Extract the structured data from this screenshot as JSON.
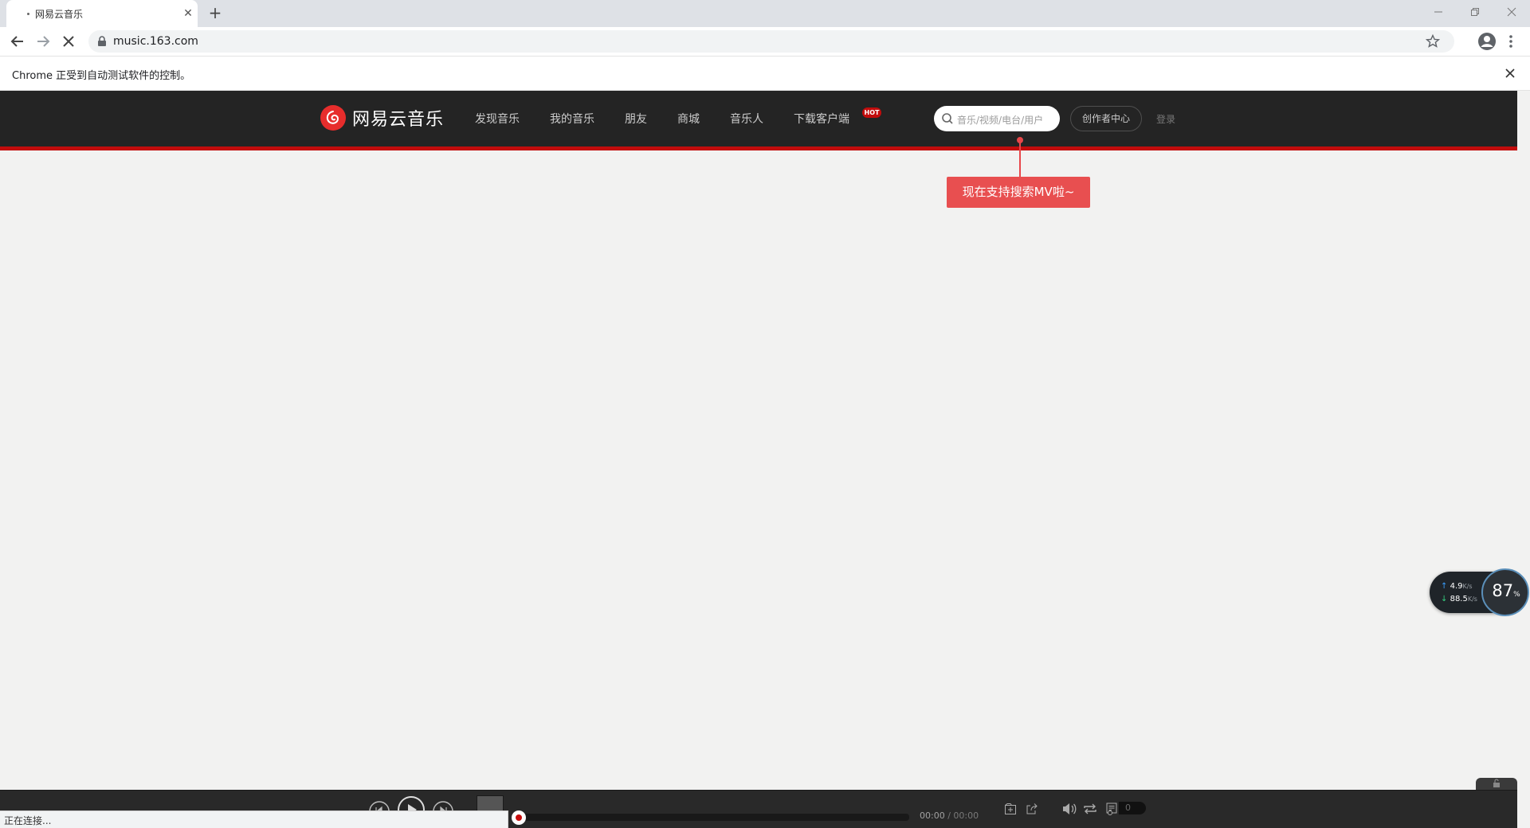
{
  "browser": {
    "tab": {
      "title": "网易云音乐"
    },
    "url": "music.163.com",
    "infobar": {
      "text": "Chrome 正受到自动测试软件的控制。"
    },
    "status": "正在连接..."
  },
  "site": {
    "logo_text": "网易云音乐",
    "nav": [
      "发现音乐",
      "我的音乐",
      "朋友",
      "商城",
      "音乐人",
      "下载客户端"
    ],
    "hot_badge": "HOT",
    "search_placeholder": "音乐/视频/电台/用户",
    "creator_label": "创作者中心",
    "login_label": "登录",
    "tooltip": "现在支持搜索MV啦~",
    "brand_color": "#c20c0c"
  },
  "net_widget": {
    "up_speed": "4.9",
    "down_speed": "88.5",
    "unit": "K/s",
    "percent": "87",
    "percent_sign": "%"
  },
  "player": {
    "current_time": "00:00",
    "total_time": "/ 00:00",
    "playlist_count": "0"
  }
}
